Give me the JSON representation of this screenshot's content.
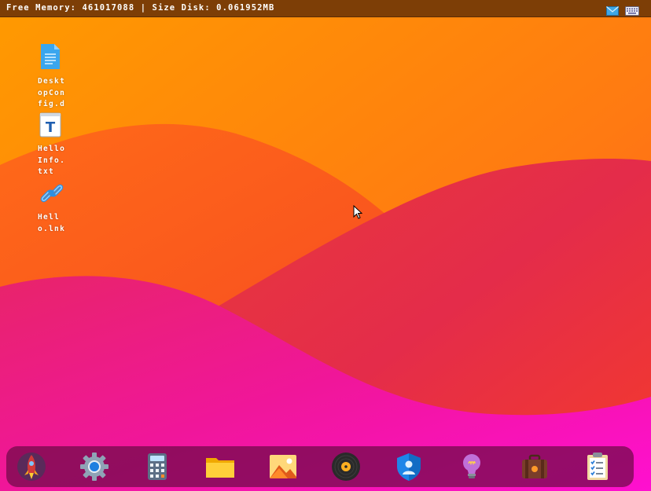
{
  "statusbar": {
    "text": "Free Memory: 461017088 | Size Disk: 0.061952MB"
  },
  "tray": {
    "icons": [
      "mail-icon",
      "keyboard-icon"
    ]
  },
  "desktop_icons": [
    {
      "label": "DesktopConfig.d",
      "icon": "document-icon"
    },
    {
      "label": "HelloInfo.txt",
      "icon": "text-file-icon"
    },
    {
      "label": "Hello.lnk",
      "icon": "link-icon"
    }
  ],
  "dock": {
    "items": [
      "rocket-icon",
      "settings-gear-icon",
      "calculator-icon",
      "folder-icon",
      "image-viewer-icon",
      "music-disc-icon",
      "security-shield-icon",
      "lightbulb-icon",
      "suitcase-icon",
      "clipboard-icon"
    ]
  },
  "colors": {
    "wallpaper_top": "#ff8c00",
    "wallpaper_mid": "#f5421d",
    "wallpaper_bottom": "#ff14c8",
    "statusbar_bg": "#7d3e06",
    "dock_bg": "#6e0a46"
  }
}
